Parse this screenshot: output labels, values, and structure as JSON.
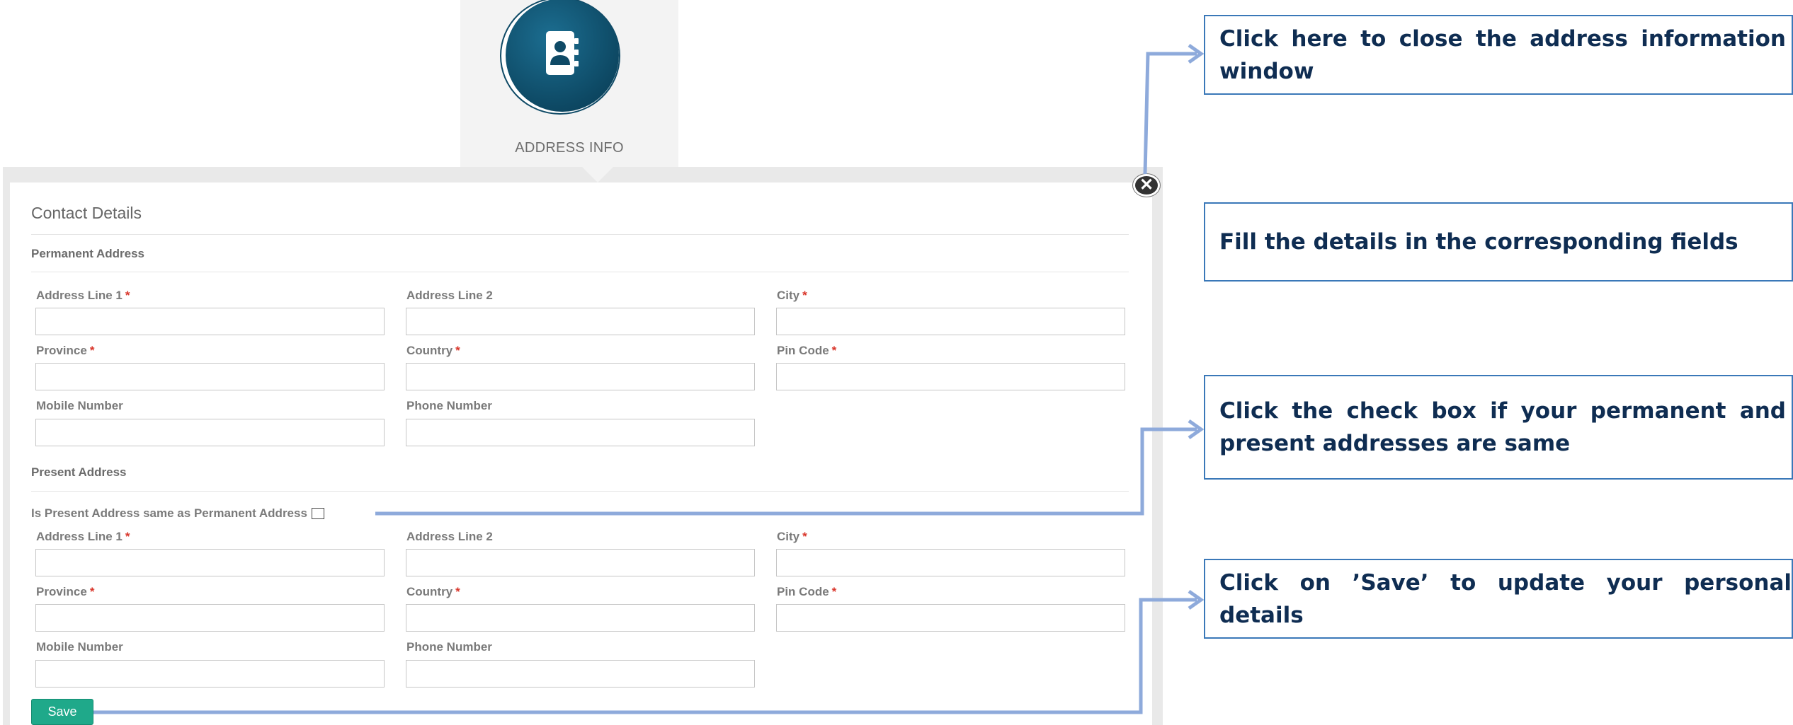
{
  "tile": {
    "label": "ADDRESS INFO",
    "icon": "address-book-icon"
  },
  "modal": {
    "title": "Contact Details",
    "close_icon": "close-icon",
    "permanent": {
      "title": "Permanent Address",
      "fields": [
        {
          "label": "Address Line 1",
          "required": "*",
          "value": ""
        },
        {
          "label": "Address Line 2",
          "required": "",
          "value": ""
        },
        {
          "label": "City",
          "required": "*",
          "value": ""
        },
        {
          "label": "Province",
          "required": "*",
          "value": ""
        },
        {
          "label": "Country",
          "required": "*",
          "value": ""
        },
        {
          "label": "Pin Code",
          "required": "*",
          "value": ""
        },
        {
          "label": "Mobile Number",
          "required": "",
          "value": ""
        },
        {
          "label": "Phone Number",
          "required": "",
          "value": ""
        }
      ]
    },
    "present": {
      "title": "Present Address",
      "same_label": "Is Present Address same as Permanent Address",
      "same_checked": false,
      "fields": [
        {
          "label": "Address Line 1",
          "required": "*",
          "value": ""
        },
        {
          "label": "Address Line 2",
          "required": "",
          "value": ""
        },
        {
          "label": "City",
          "required": "*",
          "value": ""
        },
        {
          "label": "Province",
          "required": "*",
          "value": ""
        },
        {
          "label": "Country",
          "required": "*",
          "value": ""
        },
        {
          "label": "Pin Code",
          "required": "*",
          "value": ""
        },
        {
          "label": "Mobile Number",
          "required": "",
          "value": ""
        },
        {
          "label": "Phone Number",
          "required": "",
          "value": ""
        }
      ]
    },
    "save_label": "Save"
  },
  "callouts": {
    "close": "Click here to close the address information window",
    "fill": "Fill the details in the corresponding  fields",
    "checkbox": "Click the check box if your permanent and present addresses are same",
    "save": "Click on ’Save’ to update your personal details"
  },
  "colors": {
    "accent": "#1fa98a",
    "callout_border": "#3a78b8",
    "connector": "#8eaadb",
    "callout_text": "#0f2d52",
    "required": "#d9362b"
  }
}
